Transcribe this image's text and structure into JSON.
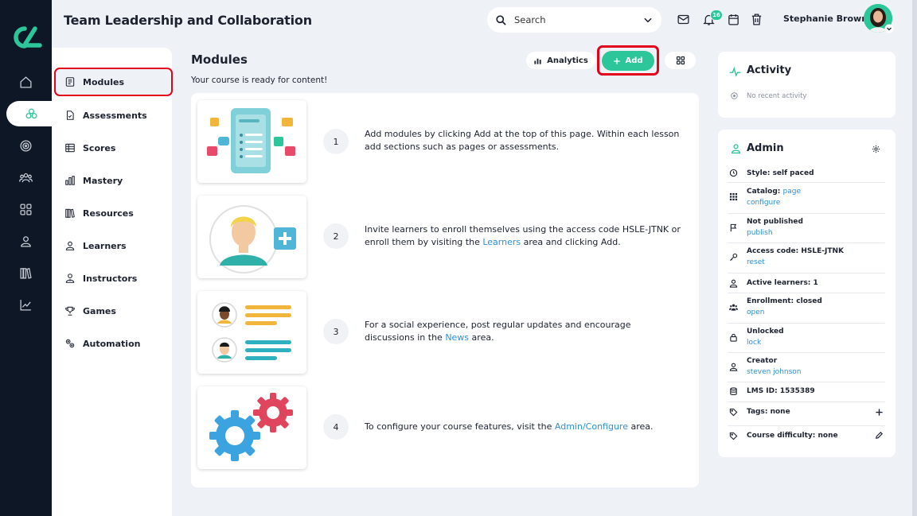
{
  "header": {
    "title": "Team Leadership and Collaboration",
    "search_placeholder": "Search",
    "notification_count": "16",
    "user_name": "Stephanie Brown"
  },
  "rail": {
    "items": [
      "home-icon",
      "courses-icon",
      "target-icon",
      "people-icon",
      "grid-icon",
      "person-icon",
      "library-icon",
      "chart-icon"
    ],
    "active_index": 1
  },
  "subnav": {
    "items": [
      {
        "label": "Modules",
        "icon": "modules-icon"
      },
      {
        "label": "Assessments",
        "icon": "assessments-icon"
      },
      {
        "label": "Scores",
        "icon": "scores-icon"
      },
      {
        "label": "Mastery",
        "icon": "mastery-icon"
      },
      {
        "label": "Resources",
        "icon": "resources-icon"
      },
      {
        "label": "Learners",
        "icon": "learners-icon"
      },
      {
        "label": "Instructors",
        "icon": "instructors-icon"
      },
      {
        "label": "Games",
        "icon": "games-icon"
      },
      {
        "label": "Automation",
        "icon": "automation-icon"
      }
    ],
    "active_index": 0
  },
  "main": {
    "title": "Modules",
    "subtitle": "Your course is ready for content!",
    "analytics_label": "Analytics",
    "add_label": "Add",
    "steps": [
      {
        "num": "1",
        "pre": "Add modules by clicking Add at the top of this page. Within each lesson add sections such as pages or assessments.",
        "link": "",
        "post": ""
      },
      {
        "num": "2",
        "pre": "Invite learners to enroll themselves using the access code HSLE-JTNK or enroll them by visiting the ",
        "link": "Learners",
        "post": " area and clicking Add."
      },
      {
        "num": "3",
        "pre": "For a social experience, post regular updates and encourage discussions in the ",
        "link": "News",
        "post": " area."
      },
      {
        "num": "4",
        "pre": "To configure your course features, visit the ",
        "link": "Admin/Configure",
        "post": " area."
      }
    ]
  },
  "activity": {
    "title": "Activity",
    "empty": "No recent activity"
  },
  "admin": {
    "title": "Admin",
    "rows": [
      {
        "label": "Style: self paced",
        "links": [],
        "icon": "clock-icon",
        "action": ""
      },
      {
        "label": "Catalog:",
        "inline_link": "page",
        "links": [
          "configure"
        ],
        "icon": "catalog-icon",
        "action": ""
      },
      {
        "label": "Not published",
        "links": [
          "publish"
        ],
        "icon": "flag-icon",
        "action": ""
      },
      {
        "label": "Access code: HSLE-JTNK",
        "links": [
          "reset"
        ],
        "icon": "key-icon",
        "action": ""
      },
      {
        "label": "Active learners: 1",
        "links": [],
        "icon": "person-icon",
        "action": ""
      },
      {
        "label": "Enrollment: closed",
        "links": [
          "open"
        ],
        "icon": "group-icon",
        "action": ""
      },
      {
        "label": "Unlocked",
        "links": [
          "lock"
        ],
        "icon": "lock-icon",
        "action": ""
      },
      {
        "label": "Creator",
        "links": [
          "steven johnson"
        ],
        "icon": "creator-icon",
        "action": ""
      },
      {
        "label": "LMS ID: 1535389",
        "links": [],
        "icon": "database-icon",
        "action": ""
      },
      {
        "label": "Tags: none",
        "links": [],
        "icon": "tag-icon",
        "action": "plus-icon"
      },
      {
        "label": "Course difficulty: none",
        "links": [],
        "icon": "tag-icon",
        "action": "pencil-icon"
      }
    ]
  },
  "colors": {
    "accent": "#2dc59a",
    "rail": "#0d1726",
    "highlight": "#e3001a",
    "link": "#2b8fd6"
  }
}
